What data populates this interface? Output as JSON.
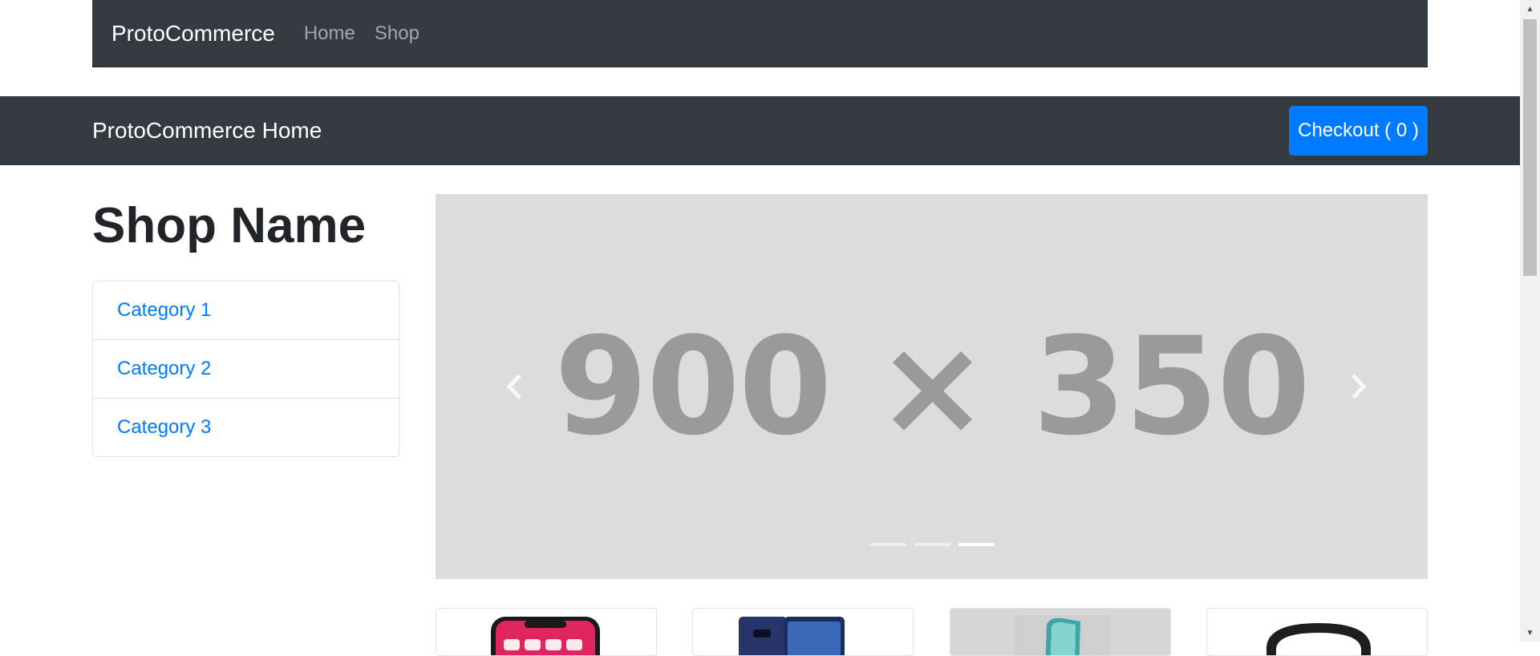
{
  "navbar": {
    "brand": "ProtoCommerce",
    "links": [
      "Home",
      "Shop"
    ]
  },
  "header": {
    "title": "ProtoCommerce Home",
    "checkout_label": "Checkout ( 0 )"
  },
  "sidebar": {
    "shop_name": "Shop Name",
    "categories": [
      "Category 1",
      "Category 2",
      "Category 3"
    ]
  },
  "carousel": {
    "placeholder_text": "900 × 350",
    "prev_icon": "chevron-left-icon",
    "next_icon": "chevron-right-icon",
    "indicator_count": 3,
    "active_indicator": 3
  },
  "products": {
    "visible_cards": 4
  },
  "colors": {
    "dark": "#343a40",
    "primary": "#007bff",
    "carousel_bg": "#dcdcdc",
    "placeholder_text": "#9a9a9a"
  }
}
